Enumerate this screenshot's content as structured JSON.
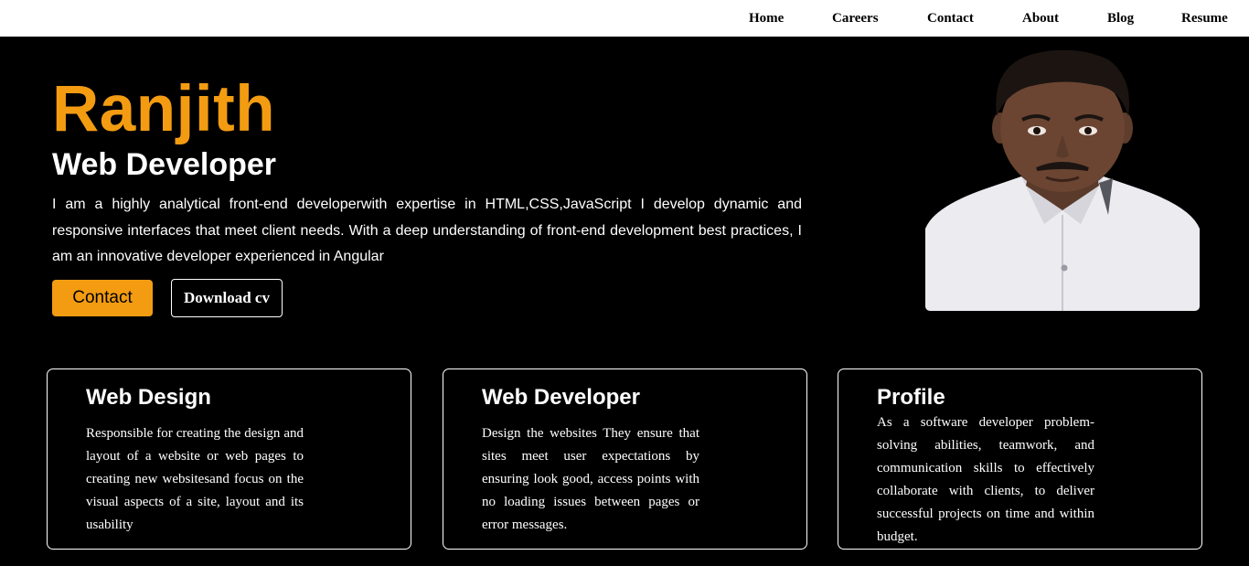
{
  "nav": {
    "items": [
      {
        "label": "Home"
      },
      {
        "label": "Careers"
      },
      {
        "label": "Contact"
      },
      {
        "label": "About"
      },
      {
        "label": "Blog"
      },
      {
        "label": "Resume"
      }
    ]
  },
  "hero": {
    "name": "Ranjith",
    "role": "Web Developer",
    "description": "I am a highly analytical front-end developerwith expertise in HTML,CSS,JavaScript I develop dynamic and responsive interfaces that meet client needs. With a deep understanding of front-end development best practices, I am an innovative developer experienced in Angular",
    "contact_label": "Contact",
    "download_label": "Download cv"
  },
  "colors": {
    "accent": "#f39c12",
    "background": "#000000",
    "nav_background": "#ffffff"
  },
  "cards": [
    {
      "title": "Web Design",
      "text": "Responsible for creating the design and layout of a website or web pages to creating new websitesand focus on the visual aspects of a site, layout and its usability"
    },
    {
      "title": "Web Developer",
      "text": "Design the websites They ensure that sites meet user expectations by ensuring look good, access points with no loading issues between pages or error messages."
    },
    {
      "title": "Profile",
      "text": "As a software developer problem-solving abilities, teamwork, and communication skills to effectively collaborate with clients, to deliver successful projects on time and within budget."
    }
  ]
}
